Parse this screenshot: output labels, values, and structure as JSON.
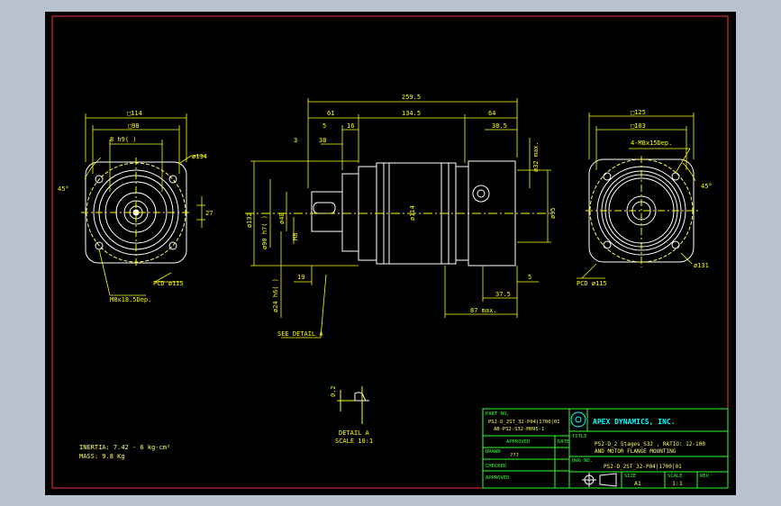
{
  "colors": {
    "background": "#000000",
    "frame": "#ff3333",
    "geometry": "#ffffff",
    "dimension": "#ffff00",
    "table": "#33ff33",
    "title_text": "#ffff66",
    "accent": "#00ffff"
  },
  "dims": {
    "front": {
      "sq114": "□114",
      "sq98": "□98",
      "m8": "8 h9(  )",
      "d134": "ø134",
      "deg45": "45°",
      "d27": "27",
      "pcd": "PCD ø115",
      "holes": "M8x18.5Dep."
    },
    "side": {
      "l259": "259.5",
      "l61": "61",
      "l134": "134.5",
      "l64": "64",
      "l5": "5",
      "l16": "16",
      "l3": "3",
      "l38": "38",
      "l385": "38.5",
      "d132": "ø132",
      "d90": "ø90 h7(  )",
      "d40": "ø40",
      "d114": "ø114",
      "d32max": "ø32 max.",
      "d95": "ø95",
      "l19": "19",
      "l375": "37.5",
      "l5b": "5",
      "l87": "87 max.",
      "d24": "ø24 h6(  )",
      "m8s": "M8",
      "detail_ref": "SEE DETAIL A"
    },
    "rear": {
      "sq125": "□125",
      "sq103": "□103",
      "holes": "4-M8x15Dep.",
      "deg45": "45°",
      "pcd": "PCD ø115",
      "d131": "ø131"
    },
    "detail": {
      "d02": "0.2",
      "title": "DETAIL A",
      "scale": "SCALE 10:1"
    }
  },
  "notes": {
    "inertia": "INERTIA: 7.42 - 6 kg-cm²",
    "mass": "MASS: 9.8 Kg"
  },
  "title_block": {
    "part_no_label": "PART NO.",
    "part_no_1": "PS2-D_2ST_32-P04|1700|01",
    "part_no_2": "AB-PS2-S32-M095-1",
    "company": "APEX DYNAMICS, INC.",
    "approved_label": "APPROVED",
    "date_label": "DATE",
    "title_label": "TITLE",
    "title_1": "PS2-D_2 Stages_S32 , RATIO: 12-100",
    "title_2": "AND MOTOR FLANGE MOUNTING",
    "drawn_label": "DRAWN",
    "drawn_value": "???",
    "dwg_label": "DWG NO.",
    "dwg_value": "PS2-D_2ST_32-P04|1700|01",
    "checked_label": "CHECKED",
    "approved2_label": "APPROVED",
    "size_label": "SIZE",
    "size_value": "A1",
    "scale_label": "SCALE",
    "scale_value": "1:1",
    "rev_label": "REV"
  }
}
